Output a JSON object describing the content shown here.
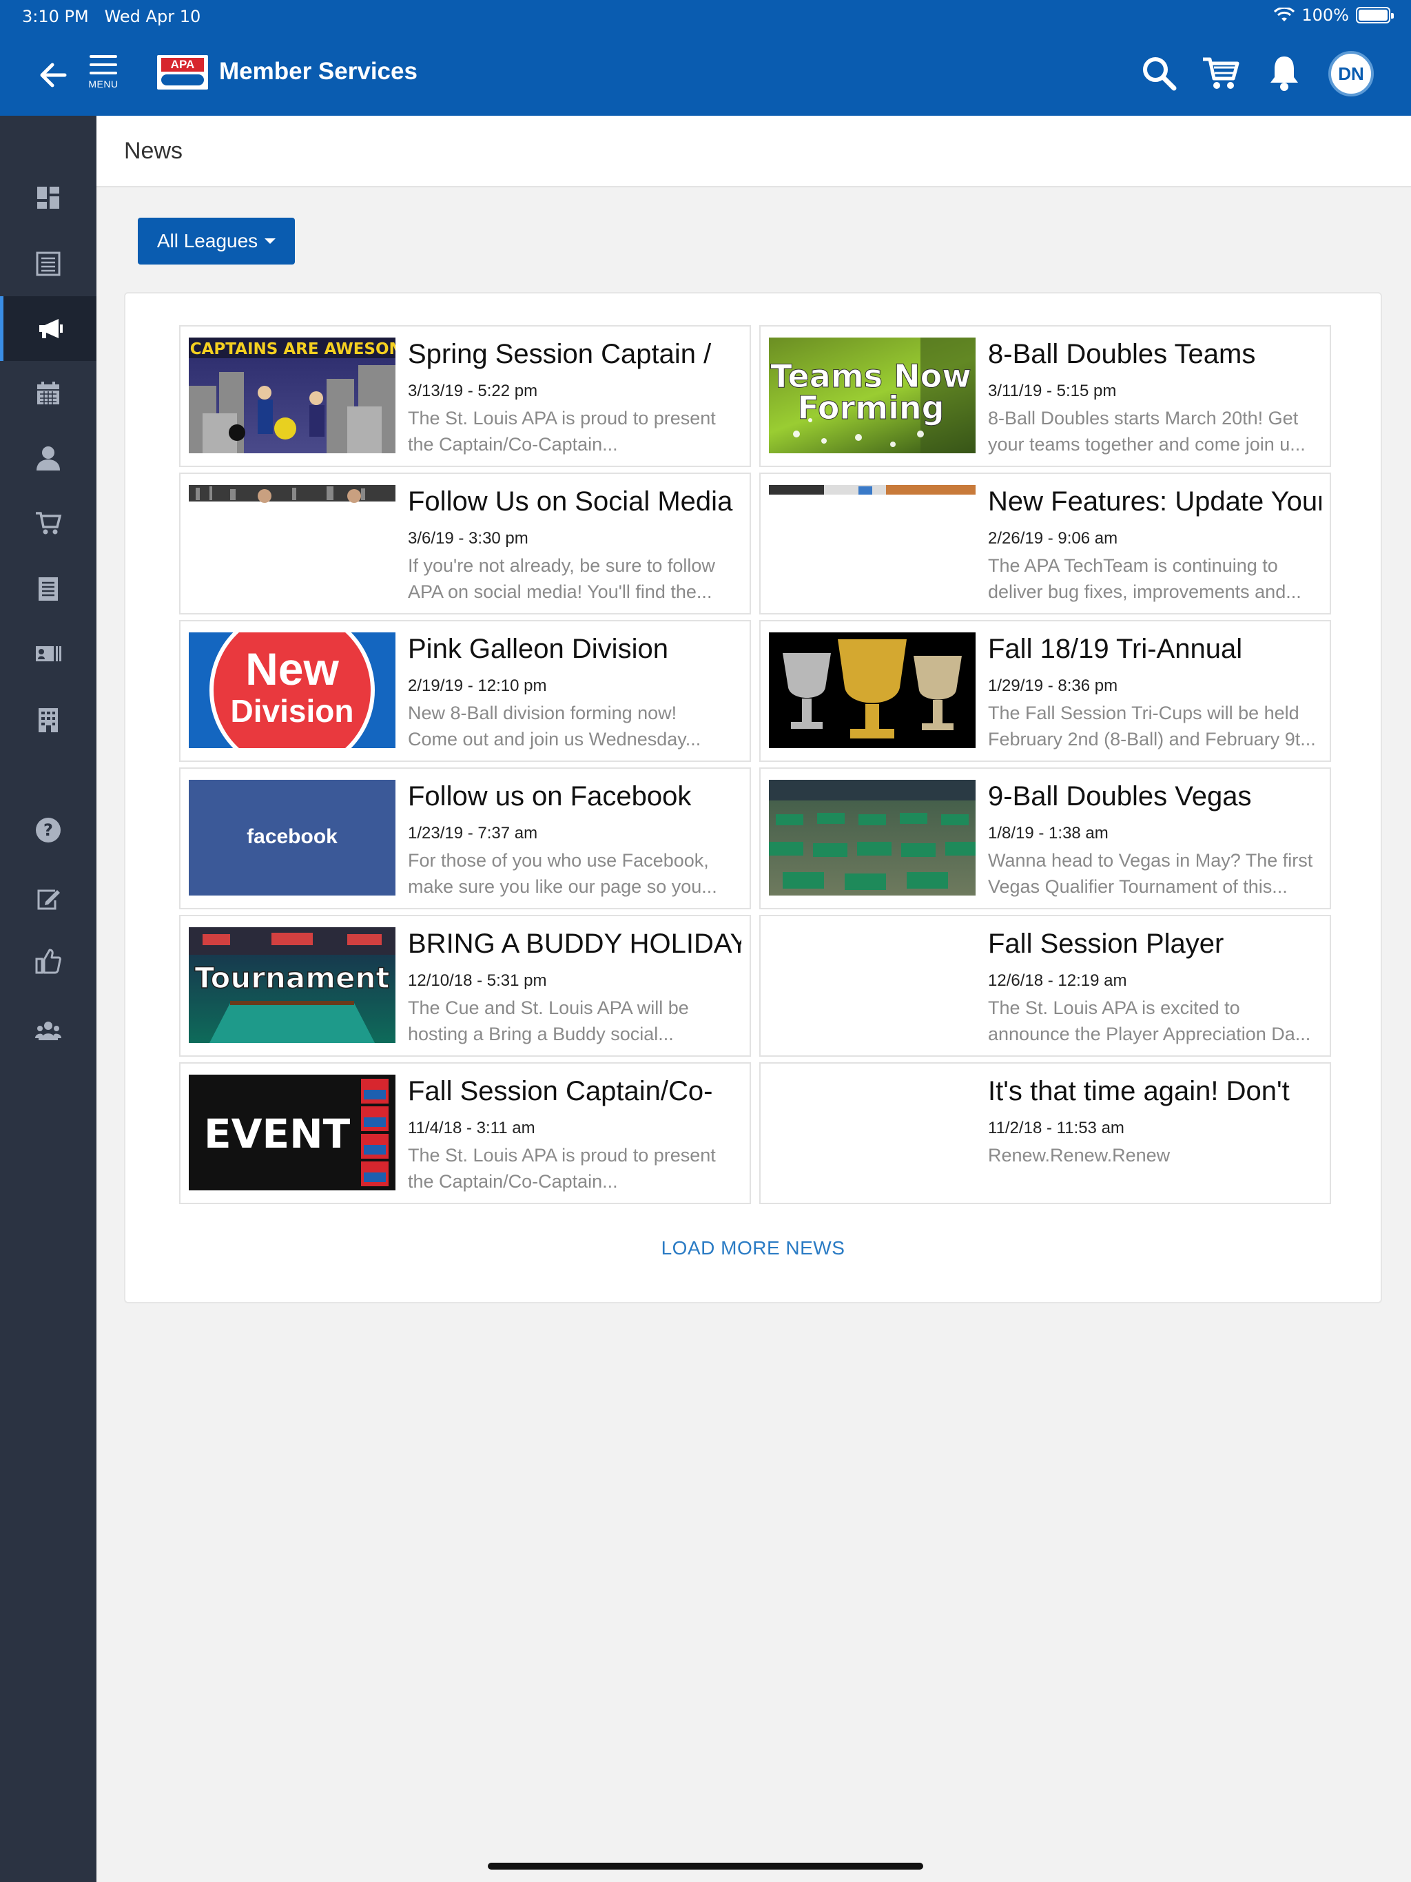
{
  "status_bar": {
    "time": "3:10 PM",
    "date": "Wed Apr 10",
    "battery": "100%"
  },
  "header": {
    "menu_label": "MENU",
    "logo_text": "APA",
    "app_title": "Member Services",
    "avatar_initials": "DN"
  },
  "page": {
    "title": "News",
    "filter_label": "All Leagues",
    "load_more": "LOAD MORE NEWS"
  },
  "thumb_text": {
    "captains": "M CAPTAINS ARE AWESOME",
    "teams_line1": "Teams Now",
    "teams_line2": "Forming",
    "newdiv_line1": "New",
    "newdiv_line2": "Division",
    "facebook": "facebook",
    "tournament": "Tournament",
    "event": "EVENT"
  },
  "news": [
    {
      "title": "Spring Session Captain /",
      "date": "3/13/19 - 5:22 pm",
      "line1": "The St. Louis APA is proud to present",
      "line2": "the Captain/Co-Captain..."
    },
    {
      "title": "8-Ball Doubles Teams",
      "date": "3/11/19 - 5:15 pm",
      "line1": "8-Ball Doubles starts March 20th! Get",
      "line2": "your teams together and come join u..."
    },
    {
      "title": "Follow Us on Social Media",
      "date": "3/6/19 - 3:30 pm",
      "line1": "If you're not already, be sure to follow",
      "line2": "APA on social media! You'll find the..."
    },
    {
      "title": "New Features: Update Your",
      "date": "2/26/19 - 9:06 am",
      "line1": "The APA TechTeam is continuing to",
      "line2": "deliver bug fixes, improvements and..."
    },
    {
      "title": "Pink Galleon Division",
      "date": "2/19/19 - 12:10 pm",
      "line1": "New 8-Ball division forming now!",
      "line2": "Come out and join us Wednesday..."
    },
    {
      "title": "Fall 18/19 Tri-Annual",
      "date": "1/29/19 - 8:36 pm",
      "line1": "The Fall Session Tri-Cups will be held",
      "line2": "February 2nd (8-Ball) and February 9t..."
    },
    {
      "title": "Follow us on Facebook",
      "date": "1/23/19 - 7:37 am",
      "line1": "For those of you who use Facebook,",
      "line2": "make sure you like our page so you..."
    },
    {
      "title": "9-Ball Doubles Vegas",
      "date": "1/8/19 - 1:38 am",
      "line1": "Wanna head to Vegas in May? The first",
      "line2": "Vegas Qualifier Tournament of this..."
    },
    {
      "title": "BRING A BUDDY HOLIDAY",
      "date": "12/10/18 - 5:31 pm",
      "line1": "The Cue and St. Louis APA will be",
      "line2": "hosting a Bring a Buddy social..."
    },
    {
      "title": "Fall Session Player",
      "date": "12/6/18 - 12:19 am",
      "line1": "The St. Louis APA is excited to",
      "line2": "announce the Player Appreciation Da..."
    },
    {
      "title": "Fall Session Captain/Co-",
      "date": "11/4/18 - 3:11 am",
      "line1": "The St. Louis APA is proud to present",
      "line2": "the Captain/Co-Captain..."
    },
    {
      "title": "It's that time again! Don't",
      "date": "11/2/18 - 11:53 am",
      "line1": "Renew.Renew.Renew",
      "line2": ""
    }
  ],
  "colors": {
    "brand_blue": "#0a5cb0",
    "sidebar": "#2b3342",
    "link": "#2a7bc4"
  },
  "icons": {
    "sidebar": [
      "dashboard-icon",
      "list-icon",
      "megaphone-icon",
      "calendar-icon",
      "user-icon",
      "cart-icon",
      "document-icon",
      "id-card-icon",
      "building-icon",
      "help-icon",
      "edit-icon",
      "thumbs-up-icon",
      "team-icon"
    ],
    "top": [
      "back-arrow-icon",
      "menu-icon",
      "search-icon",
      "cart-icon",
      "bell-icon"
    ]
  }
}
